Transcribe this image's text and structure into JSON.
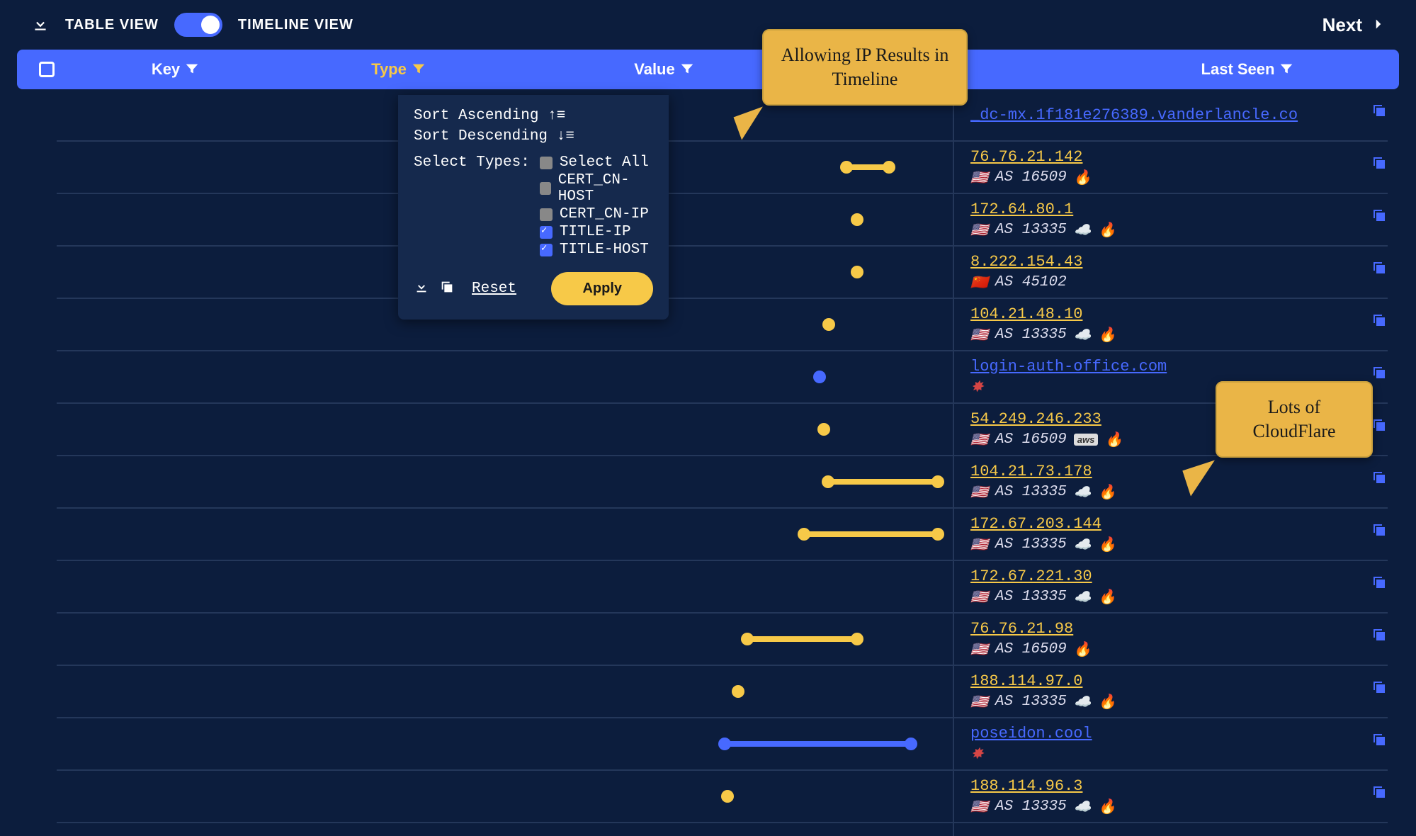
{
  "topbar": {
    "table_view": "TABLE VIEW",
    "timeline_view": "TIMELINE VIEW",
    "next": "Next"
  },
  "columns": {
    "key": "Key",
    "type": "Type",
    "value": "Value",
    "last_seen": "Last Seen"
  },
  "filter_popup": {
    "sort_asc": "Sort Ascending",
    "sort_desc": "Sort Descending",
    "select_types_label": "Select Types:",
    "options": [
      {
        "label": "Select All",
        "checked": false
      },
      {
        "label": "CERT_CN-HOST",
        "checked": false
      },
      {
        "label": "CERT_CN-IP",
        "checked": false
      },
      {
        "label": "TITLE-IP",
        "checked": true
      },
      {
        "label": "TITLE-HOST",
        "checked": true
      }
    ],
    "reset": "Reset",
    "apply": "Apply"
  },
  "callouts": {
    "c1_line1": "Allowing IP Results in",
    "c1_line2": "Timeline",
    "c2_line1": "Lots of",
    "c2_line2": "CloudFlare"
  },
  "rows": [
    {
      "link": "_dc-mx.1f181e276389.vanderlancle.co",
      "link_color": "blue",
      "flag": "",
      "asn": "",
      "icons": [],
      "timeline": {
        "type": "none"
      }
    },
    {
      "link": "76.76.21.142",
      "link_color": "yellow",
      "flag": "🇺🇸",
      "asn": "AS 16509",
      "icons": [
        "fire"
      ],
      "timeline": {
        "type": "line",
        "color": "yellow",
        "start": 1115,
        "end": 1175
      }
    },
    {
      "link": "172.64.80.1",
      "link_color": "yellow",
      "flag": "🇺🇸",
      "asn": "AS 13335",
      "icons": [
        "cloud",
        "fire"
      ],
      "timeline": {
        "type": "dot",
        "color": "yellow",
        "pos": 1130
      }
    },
    {
      "link": "8.222.154.43",
      "link_color": "yellow",
      "flag": "🇨🇳",
      "asn": "AS 45102",
      "icons": [],
      "timeline": {
        "type": "dot",
        "color": "yellow",
        "pos": 1130
      }
    },
    {
      "link": "104.21.48.10",
      "link_color": "yellow",
      "flag": "🇺🇸",
      "asn": "AS 13335",
      "icons": [
        "cloud",
        "fire"
      ],
      "timeline": {
        "type": "dot",
        "color": "yellow",
        "pos": 1090
      }
    },
    {
      "link": "login-auth-office.com",
      "link_color": "blue",
      "flag": "",
      "asn": "",
      "icons": [
        "burst"
      ],
      "timeline": {
        "type": "dot",
        "color": "blue",
        "pos": 1077
      }
    },
    {
      "link": "54.249.246.233",
      "link_color": "yellow",
      "flag": "🇺🇸",
      "asn": "AS 16509",
      "icons": [
        "aws",
        "fire"
      ],
      "timeline": {
        "type": "dot",
        "color": "yellow",
        "pos": 1083
      }
    },
    {
      "link": "104.21.73.178",
      "link_color": "yellow",
      "flag": "🇺🇸",
      "asn": "AS 13335",
      "icons": [
        "cloud",
        "fire"
      ],
      "timeline": {
        "type": "line",
        "color": "yellow",
        "start": 1089,
        "end": 1244
      }
    },
    {
      "link": "172.67.203.144",
      "link_color": "yellow",
      "flag": "🇺🇸",
      "asn": "AS 13335",
      "icons": [
        "cloud",
        "fire"
      ],
      "timeline": {
        "type": "line",
        "color": "yellow",
        "start": 1055,
        "end": 1244
      }
    },
    {
      "link": "172.67.221.30",
      "link_color": "yellow",
      "flag": "🇺🇸",
      "asn": "AS 13335",
      "icons": [
        "cloud",
        "fire"
      ],
      "timeline": {
        "type": "none"
      }
    },
    {
      "link": "76.76.21.98",
      "link_color": "yellow",
      "flag": "🇺🇸",
      "asn": "AS 16509",
      "icons": [
        "fire"
      ],
      "timeline": {
        "type": "line",
        "color": "yellow",
        "start": 975,
        "end": 1130
      }
    },
    {
      "link": "188.114.97.0",
      "link_color": "yellow",
      "flag": "🇺🇸",
      "asn": "AS 13335",
      "icons": [
        "cloud",
        "fire"
      ],
      "timeline": {
        "type": "dot",
        "color": "yellow",
        "pos": 962
      }
    },
    {
      "link": "poseidon.cool",
      "link_color": "blue",
      "flag": "",
      "asn": "",
      "icons": [
        "burst"
      ],
      "timeline": {
        "type": "line",
        "color": "blue",
        "start": 943,
        "end": 1206
      }
    },
    {
      "link": "188.114.96.3",
      "link_color": "yellow",
      "flag": "🇺🇸",
      "asn": "AS 13335",
      "icons": [
        "cloud",
        "fire"
      ],
      "timeline": {
        "type": "dot",
        "color": "yellow",
        "pos": 947
      }
    }
  ]
}
